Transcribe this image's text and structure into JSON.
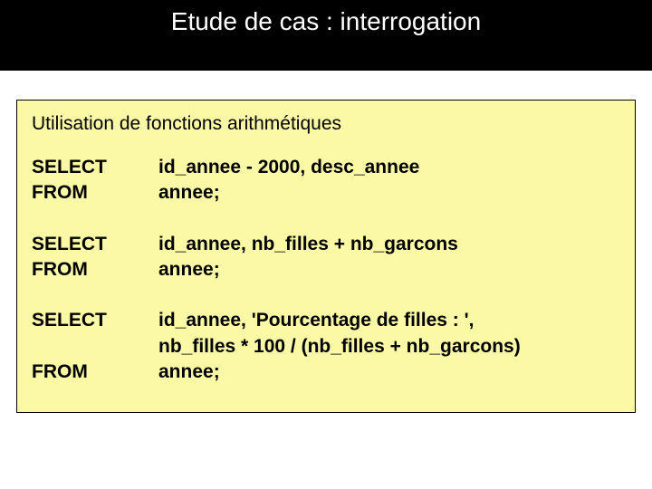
{
  "header": {
    "title": "Etude de cas : interrogation"
  },
  "box": {
    "title": "Utilisation de fonctions arithmétiques",
    "queries": [
      {
        "rows": [
          {
            "keyword": "SELECT",
            "value": "id_annee - 2000, desc_annee"
          },
          {
            "keyword": "FROM",
            "value": "annee;"
          }
        ]
      },
      {
        "rows": [
          {
            "keyword": "SELECT",
            "value": "id_annee, nb_filles +  nb_garcons"
          },
          {
            "keyword": "FROM",
            "value": "annee;"
          }
        ]
      },
      {
        "rows": [
          {
            "keyword": "SELECT",
            "value": "id_annee,  'Pourcentage de filles : ',"
          },
          {
            "keyword": "",
            "value": "nb_filles * 100 / (nb_filles +  nb_garcons)"
          },
          {
            "keyword": "FROM",
            "value": "annee;"
          }
        ]
      }
    ]
  }
}
